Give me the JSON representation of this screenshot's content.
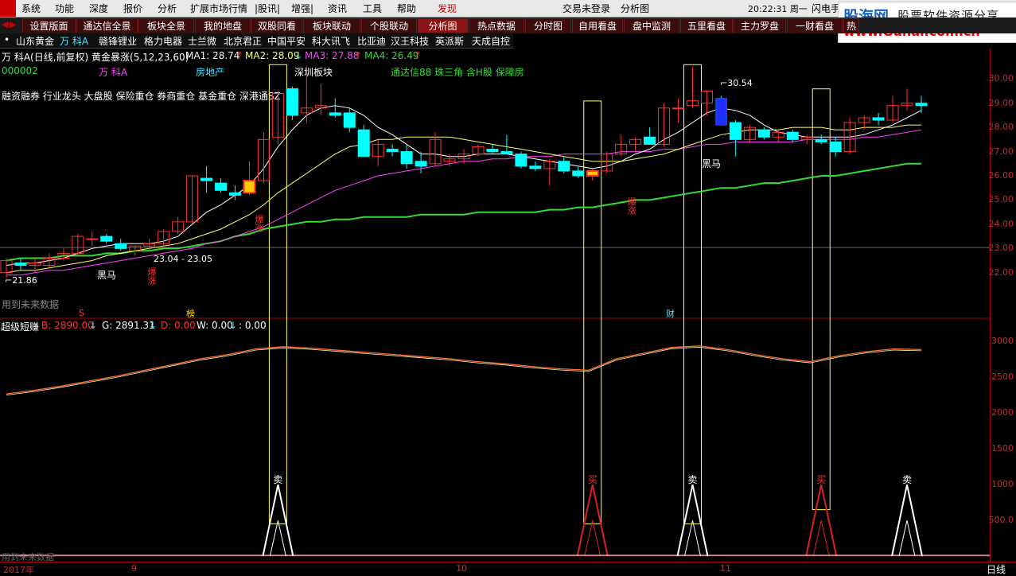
{
  "menu": {
    "items": [
      "系统",
      "功能",
      "深度",
      "报价",
      "分析",
      "扩展市场行情",
      "|股讯|",
      "增强|",
      "资讯",
      "工具",
      "帮助",
      "发现"
    ],
    "center_status": "交易未登录",
    "center_view": "分析图",
    "clock": "20:22:31 周一",
    "right_item": "闪电手"
  },
  "logo": {
    "brand": "股海网",
    "slogan": "股票软件资源分享",
    "url": "www.Guhai.com.cn"
  },
  "tabs": [
    "设置版面",
    "通达信全景",
    "板块全景",
    "我的地盘",
    "双股同看",
    "板块联动",
    "个股联动",
    "分析图",
    "热点数据",
    "分时图",
    "自用看盘",
    "盘中监测",
    "五里看盘",
    "主力罗盘",
    "一财看盘",
    "热"
  ],
  "active_tab_index": 7,
  "stocks": [
    "•",
    "山东黄金",
    "万 科A",
    "赣锋锂业",
    "格力电器",
    "士兰微",
    "北京君正",
    "中国平安",
    "科大讯飞",
    "比亚迪",
    "汉王科技",
    "英派斯",
    "天成自控"
  ],
  "selected_stock_index": 2,
  "header": {
    "line1_prefix": "万 科A(日线,前复权) 黄金暴涨(5,12,23,60)",
    "ma1": "MA1: 28.74",
    "ma2": "MA2: 28.09",
    "ma3": "MA3: 27.88",
    "ma4": "MA4: 26.49",
    "code": "000002",
    "name": "万 科A",
    "industry": "房地产",
    "board": "深圳板块",
    "concepts": "通达信88 珠三角 含H股 保障房",
    "tags": "融资融券 行业龙头 大盘股 保险重仓 券商重仓 基金重仓 深港通SZ"
  },
  "annotations": {
    "high_price": "30.54",
    "low_price": "21.86",
    "level_label": "23.04 - 23.05",
    "future_data": "用到未来数据",
    "heima": "黑马",
    "baozhang": "爆涨",
    "sign_s": "S",
    "sign_bang": "榜",
    "sign_cai": "财",
    "sell": "卖",
    "buy": "买"
  },
  "indicator": {
    "name": "超级短赚",
    "b": "B: 2890.00",
    "g": "G: 2891.31",
    "d": "D: 0.00",
    "w": "W: 0.00",
    "extra": ": 0.00"
  },
  "price_axis": [
    "30.00",
    "29.00",
    "28.00",
    "27.00",
    "26.00",
    "25.00",
    "24.00",
    "23.00",
    "22.00"
  ],
  "indicator_axis": [
    "3000",
    "2500",
    "2000",
    "1500",
    "1000",
    "500.0"
  ],
  "time_axis": {
    "labels": [
      "2017年",
      "9",
      "10",
      "11"
    ],
    "period": "日线"
  },
  "colors": {
    "up": "#ff3232",
    "down": "#00ffff",
    "ma1": "#ffffff",
    "ma2": "#ffff66",
    "ma3": "#ff40ff",
    "ma4": "#33dd33",
    "accent": "#c00000"
  },
  "chart_data": {
    "type": "candlestick",
    "candles": [
      {
        "o": 22.0,
        "h": 22.6,
        "l": 21.8,
        "c": 22.5
      },
      {
        "o": 22.4,
        "h": 22.6,
        "l": 22.1,
        "c": 22.3
      },
      {
        "o": 22.3,
        "h": 22.6,
        "l": 22.0,
        "c": 22.4
      },
      {
        "o": 22.3,
        "h": 22.8,
        "l": 22.2,
        "c": 22.6
      },
      {
        "o": 22.6,
        "h": 23.0,
        "l": 22.5,
        "c": 22.8
      },
      {
        "o": 22.8,
        "h": 23.6,
        "l": 22.7,
        "c": 23.5
      },
      {
        "o": 23.4,
        "h": 23.7,
        "l": 23.1,
        "c": 23.4
      },
      {
        "o": 23.5,
        "h": 23.6,
        "l": 23.2,
        "c": 23.3
      },
      {
        "o": 23.2,
        "h": 23.4,
        "l": 22.9,
        "c": 23.0
      },
      {
        "o": 22.9,
        "h": 23.1,
        "l": 22.7,
        "c": 23.1
      },
      {
        "o": 23.1,
        "h": 23.4,
        "l": 22.9,
        "c": 23.2
      },
      {
        "o": 23.2,
        "h": 23.8,
        "l": 23.1,
        "c": 23.7
      },
      {
        "o": 23.7,
        "h": 24.3,
        "l": 23.6,
        "c": 24.1
      },
      {
        "o": 24.1,
        "h": 26.0,
        "l": 24.0,
        "c": 26.0
      },
      {
        "o": 25.9,
        "h": 26.4,
        "l": 25.3,
        "c": 25.8
      },
      {
        "o": 25.7,
        "h": 25.9,
        "l": 25.3,
        "c": 25.4
      },
      {
        "o": 25.3,
        "h": 25.6,
        "l": 25.0,
        "c": 25.2
      },
      {
        "o": 25.3,
        "h": 26.6,
        "l": 25.2,
        "c": 25.8
      },
      {
        "o": 25.8,
        "h": 27.8,
        "l": 25.7,
        "c": 27.5
      },
      {
        "o": 27.6,
        "h": 29.5,
        "l": 27.3,
        "c": 29.4
      },
      {
        "o": 29.6,
        "h": 29.7,
        "l": 28.3,
        "c": 28.5
      },
      {
        "o": 28.6,
        "h": 30.5,
        "l": 28.2,
        "c": 28.8
      },
      {
        "o": 28.8,
        "h": 29.8,
        "l": 28.5,
        "c": 28.9
      },
      {
        "o": 28.6,
        "h": 29.2,
        "l": 28.4,
        "c": 28.5
      },
      {
        "o": 28.6,
        "h": 28.8,
        "l": 27.8,
        "c": 28.0
      },
      {
        "o": 27.9,
        "h": 28.1,
        "l": 26.8,
        "c": 26.8
      },
      {
        "o": 26.8,
        "h": 27.5,
        "l": 26.4,
        "c": 27.3
      },
      {
        "o": 27.1,
        "h": 27.3,
        "l": 26.8,
        "c": 27.0
      },
      {
        "o": 27.0,
        "h": 27.3,
        "l": 26.3,
        "c": 26.5
      },
      {
        "o": 26.6,
        "h": 27.0,
        "l": 26.1,
        "c": 26.4
      },
      {
        "o": 26.5,
        "h": 27.8,
        "l": 26.4,
        "c": 27.5
      },
      {
        "o": 26.6,
        "h": 26.9,
        "l": 26.4,
        "c": 26.7
      },
      {
        "o": 26.7,
        "h": 27.1,
        "l": 26.5,
        "c": 26.9
      },
      {
        "o": 26.9,
        "h": 27.3,
        "l": 26.8,
        "c": 27.2
      },
      {
        "o": 27.1,
        "h": 27.3,
        "l": 26.9,
        "c": 27.0
      },
      {
        "o": 27.0,
        "h": 27.7,
        "l": 26.9,
        "c": 26.9
      },
      {
        "o": 26.9,
        "h": 27.0,
        "l": 26.3,
        "c": 26.4
      },
      {
        "o": 26.4,
        "h": 26.6,
        "l": 26.2,
        "c": 26.3
      },
      {
        "o": 26.3,
        "h": 26.7,
        "l": 25.6,
        "c": 26.6
      },
      {
        "o": 26.6,
        "h": 26.8,
        "l": 26.1,
        "c": 26.2
      },
      {
        "o": 26.2,
        "h": 26.4,
        "l": 25.9,
        "c": 26.0
      },
      {
        "o": 26.0,
        "h": 26.3,
        "l": 25.8,
        "c": 26.2
      },
      {
        "o": 26.2,
        "h": 27.0,
        "l": 26.1,
        "c": 26.9
      },
      {
        "o": 26.9,
        "h": 27.7,
        "l": 26.8,
        "c": 27.3
      },
      {
        "o": 27.3,
        "h": 27.6,
        "l": 27.0,
        "c": 27.5
      },
      {
        "o": 27.6,
        "h": 28.0,
        "l": 27.3,
        "c": 27.3
      },
      {
        "o": 27.3,
        "h": 29.0,
        "l": 27.2,
        "c": 28.8
      },
      {
        "o": 28.8,
        "h": 29.2,
        "l": 28.2,
        "c": 28.8
      },
      {
        "o": 28.9,
        "h": 30.5,
        "l": 28.8,
        "c": 29.1
      },
      {
        "o": 29.0,
        "h": 29.5,
        "l": 28.5,
        "c": 29.5
      },
      {
        "o": 29.2,
        "h": 29.3,
        "l": 28.1,
        "c": 28.1
      },
      {
        "o": 28.2,
        "h": 28.3,
        "l": 26.8,
        "c": 27.5
      },
      {
        "o": 27.5,
        "h": 28.1,
        "l": 27.4,
        "c": 28.0
      },
      {
        "o": 27.9,
        "h": 28.0,
        "l": 27.5,
        "c": 27.6
      },
      {
        "o": 27.6,
        "h": 27.9,
        "l": 27.4,
        "c": 27.8
      },
      {
        "o": 27.8,
        "h": 27.9,
        "l": 27.4,
        "c": 27.5
      },
      {
        "o": 27.5,
        "h": 27.7,
        "l": 27.3,
        "c": 27.6
      },
      {
        "o": 27.5,
        "h": 27.7,
        "l": 27.3,
        "c": 27.4
      },
      {
        "o": 27.4,
        "h": 27.6,
        "l": 26.8,
        "c": 27.0
      },
      {
        "o": 27.0,
        "h": 28.4,
        "l": 26.9,
        "c": 28.2
      },
      {
        "o": 28.2,
        "h": 28.5,
        "l": 27.9,
        "c": 28.4
      },
      {
        "o": 28.4,
        "h": 28.6,
        "l": 28.1,
        "c": 28.3
      },
      {
        "o": 28.3,
        "h": 29.3,
        "l": 28.2,
        "c": 28.9
      },
      {
        "o": 28.9,
        "h": 29.6,
        "l": 28.7,
        "c": 29.0
      },
      {
        "o": 29.0,
        "h": 29.3,
        "l": 28.6,
        "c": 28.9
      }
    ],
    "ma1": [
      22.3,
      22.4,
      22.4,
      22.5,
      22.6,
      22.8,
      23.0,
      23.1,
      23.2,
      23.2,
      23.2,
      23.3,
      23.5,
      24.0,
      24.5,
      24.8,
      25.2,
      25.6,
      26.3,
      27.2,
      27.9,
      28.5,
      28.8,
      28.9,
      28.8,
      28.5,
      28.0,
      27.7,
      27.3,
      26.9,
      26.9,
      26.8,
      26.8,
      26.9,
      26.9,
      26.9,
      26.8,
      26.7,
      26.6,
      26.5,
      26.4,
      26.3,
      26.4,
      26.6,
      26.9,
      27.1,
      27.5,
      27.8,
      28.2,
      28.6,
      28.8,
      28.7,
      28.5,
      28.1,
      27.8,
      27.7,
      27.6,
      27.6,
      27.6,
      27.6,
      27.7,
      27.9,
      28.1,
      28.4,
      28.7
    ],
    "ma2": [
      22.0,
      22.1,
      22.1,
      22.2,
      22.3,
      22.4,
      22.5,
      22.7,
      22.8,
      22.9,
      23.0,
      23.1,
      23.2,
      23.4,
      23.6,
      23.8,
      24.1,
      24.4,
      24.8,
      25.3,
      25.7,
      26.1,
      26.5,
      26.9,
      27.2,
      27.3,
      27.5,
      27.5,
      27.6,
      27.6,
      27.6,
      27.6,
      27.5,
      27.4,
      27.3,
      27.2,
      27.1,
      27.0,
      26.9,
      26.8,
      26.7,
      26.6,
      26.6,
      26.6,
      26.7,
      26.8,
      26.9,
      27.1,
      27.3,
      27.5,
      27.7,
      27.8,
      27.9,
      27.9,
      27.9,
      28.0,
      28.0,
      28.0,
      27.9,
      27.9,
      28.0,
      28.0,
      28.0,
      28.1,
      28.1
    ],
    "ma3": [
      21.9,
      21.9,
      22.0,
      22.1,
      22.1,
      22.2,
      22.3,
      22.4,
      22.5,
      22.6,
      22.7,
      22.8,
      22.9,
      23.0,
      23.2,
      23.3,
      23.5,
      23.7,
      23.9,
      24.2,
      24.5,
      24.8,
      25.1,
      25.4,
      25.6,
      25.8,
      26.0,
      26.1,
      26.2,
      26.3,
      26.4,
      26.5,
      26.6,
      26.6,
      26.7,
      26.7,
      26.8,
      26.8,
      26.8,
      26.9,
      26.9,
      26.9,
      26.9,
      27.0,
      27.0,
      27.0,
      27.1,
      27.1,
      27.2,
      27.3,
      27.3,
      27.4,
      27.4,
      27.4,
      27.4,
      27.4,
      27.5,
      27.5,
      27.5,
      27.5,
      27.6,
      27.6,
      27.7,
      27.8,
      27.9
    ],
    "ma4": [
      22.5,
      22.6,
      22.6,
      22.6,
      22.7,
      22.7,
      22.7,
      22.8,
      22.8,
      22.9,
      22.9,
      23.0,
      23.0,
      23.1,
      23.2,
      23.3,
      23.5,
      23.6,
      23.8,
      23.9,
      24.0,
      24.1,
      24.1,
      24.2,
      24.2,
      24.3,
      24.3,
      24.3,
      24.3,
      24.4,
      24.4,
      24.4,
      24.4,
      24.5,
      24.5,
      24.5,
      24.5,
      24.5,
      24.6,
      24.6,
      24.7,
      24.7,
      24.8,
      24.9,
      25.0,
      25.0,
      25.1,
      25.2,
      25.3,
      25.4,
      25.5,
      25.5,
      25.6,
      25.7,
      25.7,
      25.8,
      25.9,
      26.0,
      26.0,
      26.1,
      26.2,
      26.3,
      26.4,
      26.5,
      26.5
    ],
    "indicator_line": [
      2270,
      2320,
      2380,
      2450,
      2520,
      2600,
      2680,
      2760,
      2820,
      2900,
      2930,
      2910,
      2880,
      2850,
      2820,
      2790,
      2760,
      2720,
      2690,
      2650,
      2620,
      2600,
      2760,
      2840,
      2920,
      2940,
      2890,
      2820,
      2760,
      2720,
      2800,
      2860,
      2900,
      2890
    ],
    "signal_boxes": [
      {
        "i": 19,
        "type": "sell",
        "from": 30.0,
        "to": 450
      },
      {
        "i": 41,
        "type": "buy",
        "from": 28.5,
        "to": 450
      },
      {
        "i": 48,
        "type": "sell",
        "from": 30.0,
        "to": 450
      },
      {
        "i": 57,
        "type": "buy",
        "from": 29.0,
        "to": 650
      }
    ],
    "price_range": [
      21.4,
      30.6
    ],
    "indicator_range": [
      0,
      3150
    ]
  }
}
